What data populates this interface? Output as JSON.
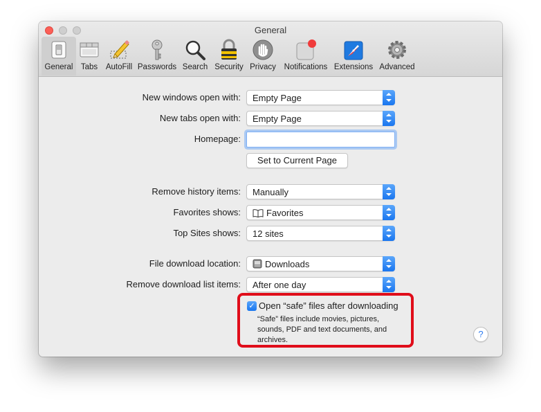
{
  "window": {
    "title": "General"
  },
  "toolbar": {
    "items": [
      {
        "label": "General",
        "icon": "general-switch-icon"
      },
      {
        "label": "Tabs",
        "icon": "tabs-icon"
      },
      {
        "label": "AutoFill",
        "icon": "pencil-icon"
      },
      {
        "label": "Passwords",
        "icon": "key-icon"
      },
      {
        "label": "Search",
        "icon": "magnifier-icon"
      },
      {
        "label": "Security",
        "icon": "padlock-icon"
      },
      {
        "label": "Privacy",
        "icon": "hand-icon"
      },
      {
        "label": "Notifications",
        "icon": "notification-badge-icon"
      },
      {
        "label": "Extensions",
        "icon": "puzzle-compass-icon"
      },
      {
        "label": "Advanced",
        "icon": "gear-icon"
      }
    ],
    "selected": "General"
  },
  "form": {
    "new_windows": {
      "label": "New windows open with:",
      "value": "Empty Page"
    },
    "new_tabs": {
      "label": "New tabs open with:",
      "value": "Empty Page"
    },
    "homepage": {
      "label": "Homepage:",
      "value": ""
    },
    "set_current_button": "Set to Current Page",
    "remove_history": {
      "label": "Remove history items:",
      "value": "Manually"
    },
    "favorites_shows": {
      "label": "Favorites shows:",
      "value": "Favorites",
      "icon": "book-icon"
    },
    "top_sites": {
      "label": "Top Sites shows:",
      "value": "12 sites"
    },
    "download_location": {
      "label": "File download location:",
      "value": "Downloads",
      "icon": "drive-icon"
    },
    "remove_download": {
      "label": "Remove download list items:",
      "value": "After one day"
    },
    "open_safe": {
      "label": "Open “safe” files after downloading",
      "checked": true,
      "description": "“Safe” files include movies, pictures, sounds, PDF and text documents, and archives."
    },
    "help_label": "?"
  },
  "colors": {
    "accent": "#1a76ef",
    "highlight": "#e00d1a"
  }
}
